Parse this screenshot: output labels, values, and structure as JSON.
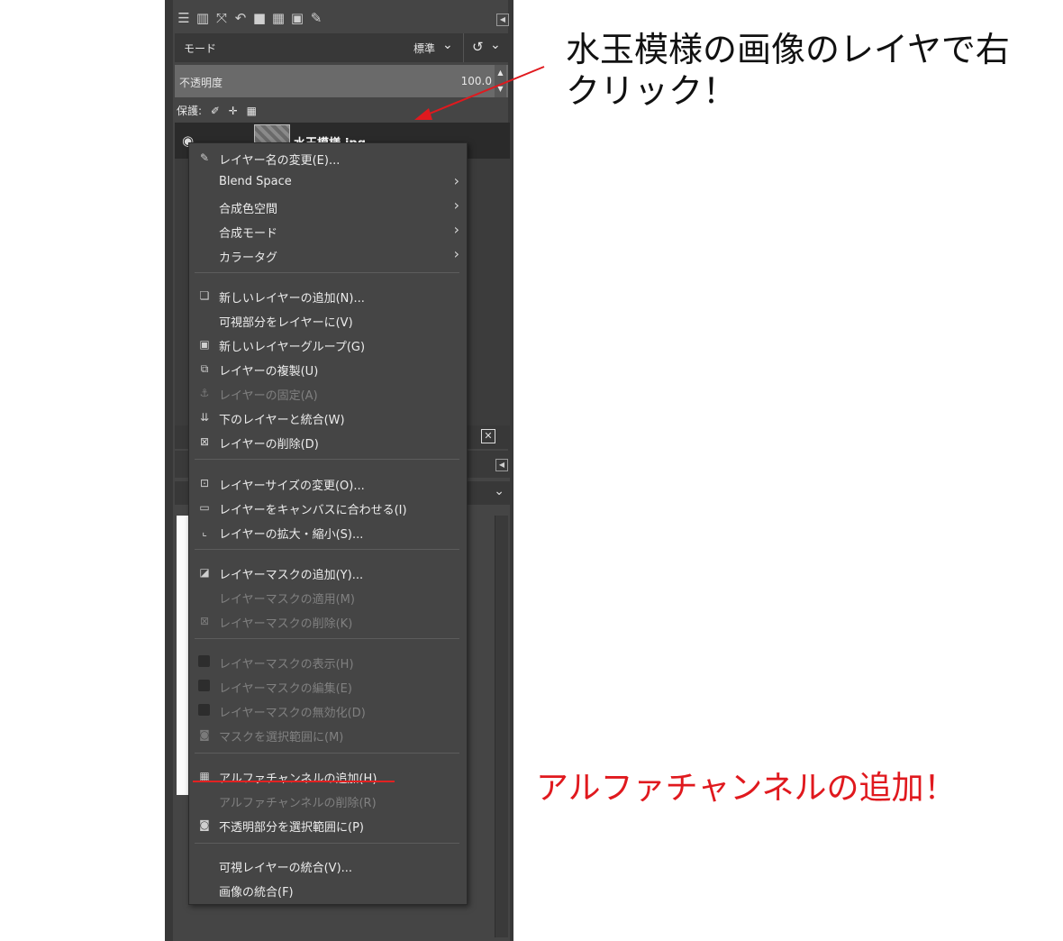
{
  "layers_dock": {
    "mode_label": "モード",
    "mode_value": "標準",
    "opacity_label": "不透明度",
    "opacity_value": "100.0",
    "lock_label": "保護:",
    "layer_name": "水玉模様.jpg"
  },
  "context_menu": {
    "items": [
      {
        "label": "レイヤー名の変更(E)...",
        "icon": "rename-icon",
        "enabled": true
      },
      {
        "label": "Blend Space",
        "submenu": true,
        "enabled": true
      },
      {
        "label": "合成色空間",
        "submenu": true,
        "enabled": true
      },
      {
        "label": "合成モード",
        "submenu": true,
        "enabled": true
      },
      {
        "label": "カラータグ",
        "submenu": true,
        "enabled": true
      },
      {
        "label": "新しいレイヤーの追加(N)...",
        "icon": "new-layer-icon",
        "enabled": true
      },
      {
        "label": "可視部分をレイヤーに(V)",
        "enabled": true
      },
      {
        "label": "新しいレイヤーグループ(G)",
        "icon": "new-group-icon",
        "enabled": true
      },
      {
        "label": "レイヤーの複製(U)",
        "icon": "duplicate-icon",
        "enabled": true
      },
      {
        "label": "レイヤーの固定(A)",
        "icon": "anchor-icon",
        "enabled": false
      },
      {
        "label": "下のレイヤーと統合(W)",
        "icon": "merge-down-icon",
        "enabled": true
      },
      {
        "label": "レイヤーの削除(D)",
        "icon": "delete-icon",
        "enabled": true
      },
      {
        "label": "レイヤーサイズの変更(O)...",
        "icon": "resize-icon",
        "enabled": true
      },
      {
        "label": "レイヤーをキャンバスに合わせる(I)",
        "icon": "fit-canvas-icon",
        "enabled": true
      },
      {
        "label": "レイヤーの拡大・縮小(S)...",
        "icon": "scale-icon",
        "enabled": true
      },
      {
        "label": "レイヤーマスクの追加(Y)...",
        "icon": "add-mask-icon",
        "enabled": true
      },
      {
        "label": "レイヤーマスクの適用(M)",
        "enabled": false
      },
      {
        "label": "レイヤーマスクの削除(K)",
        "icon": "delete-icon",
        "enabled": false
      },
      {
        "label": "レイヤーマスクの表示(H)",
        "icon": "checkbox-icon",
        "enabled": false
      },
      {
        "label": "レイヤーマスクの編集(E)",
        "icon": "checkbox-icon",
        "enabled": false
      },
      {
        "label": "レイヤーマスクの無効化(D)",
        "icon": "checkbox-icon",
        "enabled": false
      },
      {
        "label": "マスクを選択範囲に(M)",
        "icon": "selection-icon",
        "enabled": false
      },
      {
        "label": "アルファチャンネルの追加(H)",
        "icon": "alpha-icon",
        "enabled": true
      },
      {
        "label": "アルファチャンネルの削除(R)",
        "enabled": false
      },
      {
        "label": "不透明部分を選択範囲に(P)",
        "icon": "selection-icon",
        "enabled": true
      },
      {
        "label": "可視レイヤーの統合(V)...",
        "enabled": true
      },
      {
        "label": "画像の統合(F)",
        "enabled": true
      }
    ]
  },
  "annotations": {
    "right_click_note": "水玉模様の画像のレイヤで右クリック！",
    "alpha_note": "アルファチャンネルの追加！",
    "accent_color": "#e0191e"
  }
}
